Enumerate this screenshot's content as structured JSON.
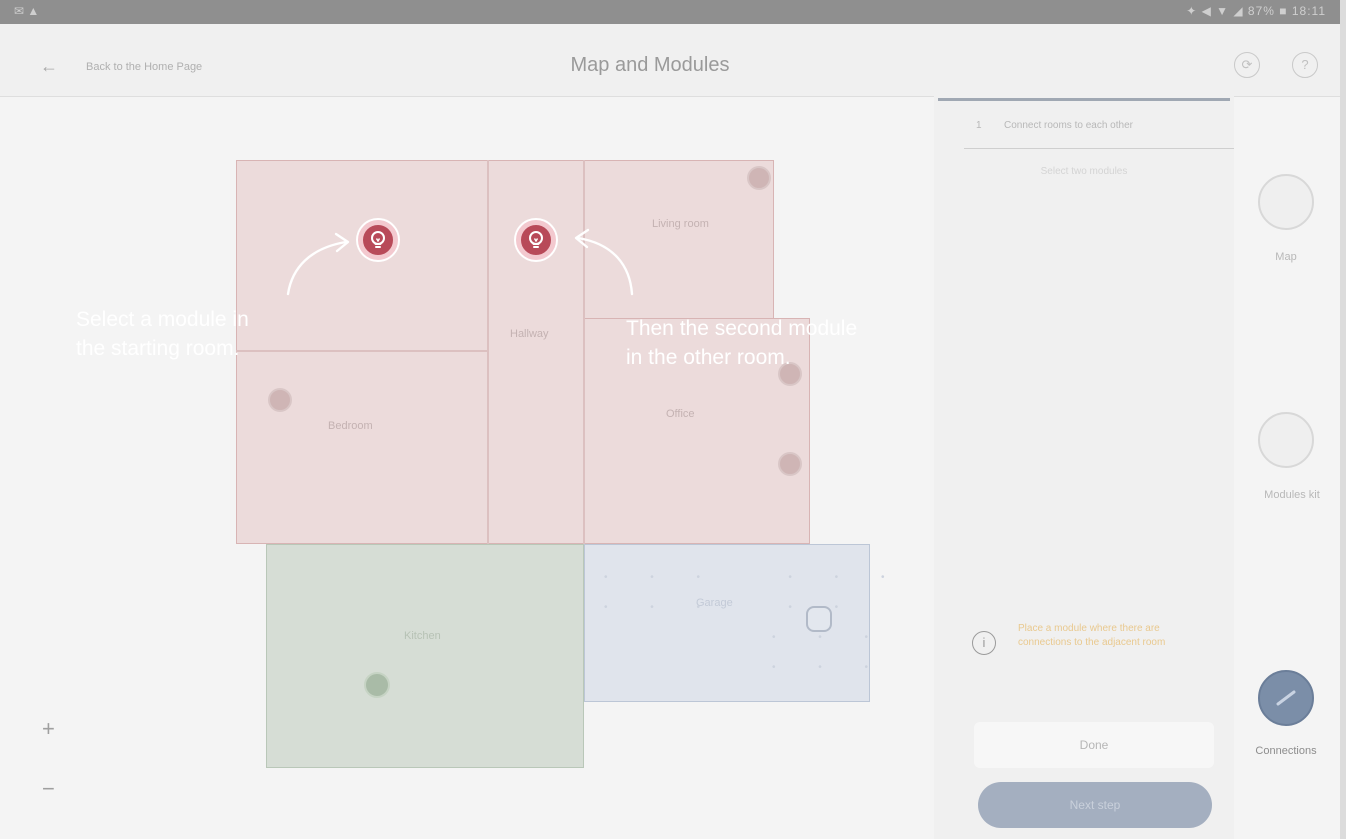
{
  "status_bar": {
    "left_icons": "✉ ▲",
    "right_text": "✦ ◀ ▼ ◢ 87% ■ 18:11"
  },
  "header": {
    "back_icon": "back-arrow-icon",
    "back_label": "Back to the Home Page",
    "title": "Map and Modules",
    "right_icons": [
      "help-circle-icon",
      "question-icon"
    ]
  },
  "floor_plan": {
    "rooms": [
      {
        "id": "room-a",
        "name": "",
        "color": "#ecdbdb"
      },
      {
        "id": "room-b",
        "name": "Bedroom",
        "color": "#ecdbdb"
      },
      {
        "id": "room-c",
        "name": "Hallway",
        "color": "#ecdbdb"
      },
      {
        "id": "room-d",
        "name": "Living room",
        "color": "#ecdbdb"
      },
      {
        "id": "room-e",
        "name": "Office",
        "color": "#ecdbdb"
      },
      {
        "id": "room-f",
        "name": "Kitchen",
        "color": "#d6ddd5"
      },
      {
        "id": "room-g",
        "name": "Garage",
        "color": "#e0e4ec"
      }
    ],
    "highlighted_modules": [
      "lightbulb-icon",
      "lightbulb-icon"
    ],
    "zoom_in": "+",
    "zoom_out": "−"
  },
  "annotations": {
    "left_line1": "Select a module in",
    "left_line2": "the starting room.",
    "right_line1": "Then the second module",
    "right_line2": "in the other room."
  },
  "panel": {
    "step_number": "1",
    "step_title": "Connect rooms to each other",
    "subtitle": "Select two modules",
    "info_icon": "info-icon",
    "warning_text": "Place a module where there are connections to the adjacent room",
    "done_label": "Done",
    "next_label": "Next step"
  },
  "sidebar": {
    "items": [
      {
        "label": "Map",
        "icon": "map-icon",
        "active": false
      },
      {
        "label": "Modules kit",
        "icon": "modules-icon",
        "active": false
      },
      {
        "label": "Connections",
        "icon": "connections-icon",
        "active": true
      }
    ]
  },
  "colors": {
    "accent_red": "#b84a59",
    "accent_blue": "#7b8ea8",
    "overlay_text": "#ffffff",
    "warning": "#e9c98f"
  }
}
